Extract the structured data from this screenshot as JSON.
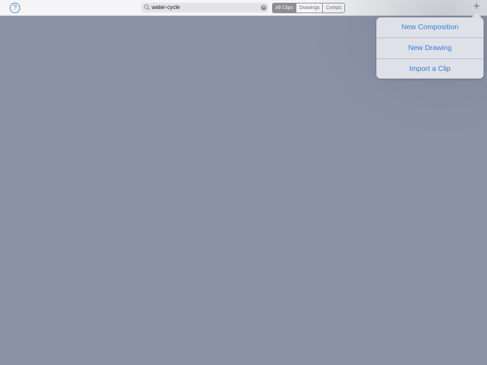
{
  "toolbar": {
    "help_icon": "question-mark-circle-icon",
    "help_glyph": "?",
    "search": {
      "value": "water-cycle",
      "icon": "magnifier-icon",
      "clear_icon": "clear-x-icon",
      "clear_glyph": "✕"
    },
    "filter_tabs": [
      {
        "label": "All Clips",
        "selected": true
      },
      {
        "label": "Drawings",
        "selected": false
      },
      {
        "label": "Comps",
        "selected": false
      }
    ],
    "add_icon": "plus-icon",
    "add_glyph": "+"
  },
  "add_menu": {
    "items": [
      {
        "label": "New Composition"
      },
      {
        "label": "New Drawing"
      },
      {
        "label": "Import a Clip"
      }
    ]
  },
  "colors": {
    "accent": "#2f7fd6",
    "background": "#8a92a6",
    "toolbar": "#f5f5f7",
    "popover": "#dfe1e9"
  }
}
